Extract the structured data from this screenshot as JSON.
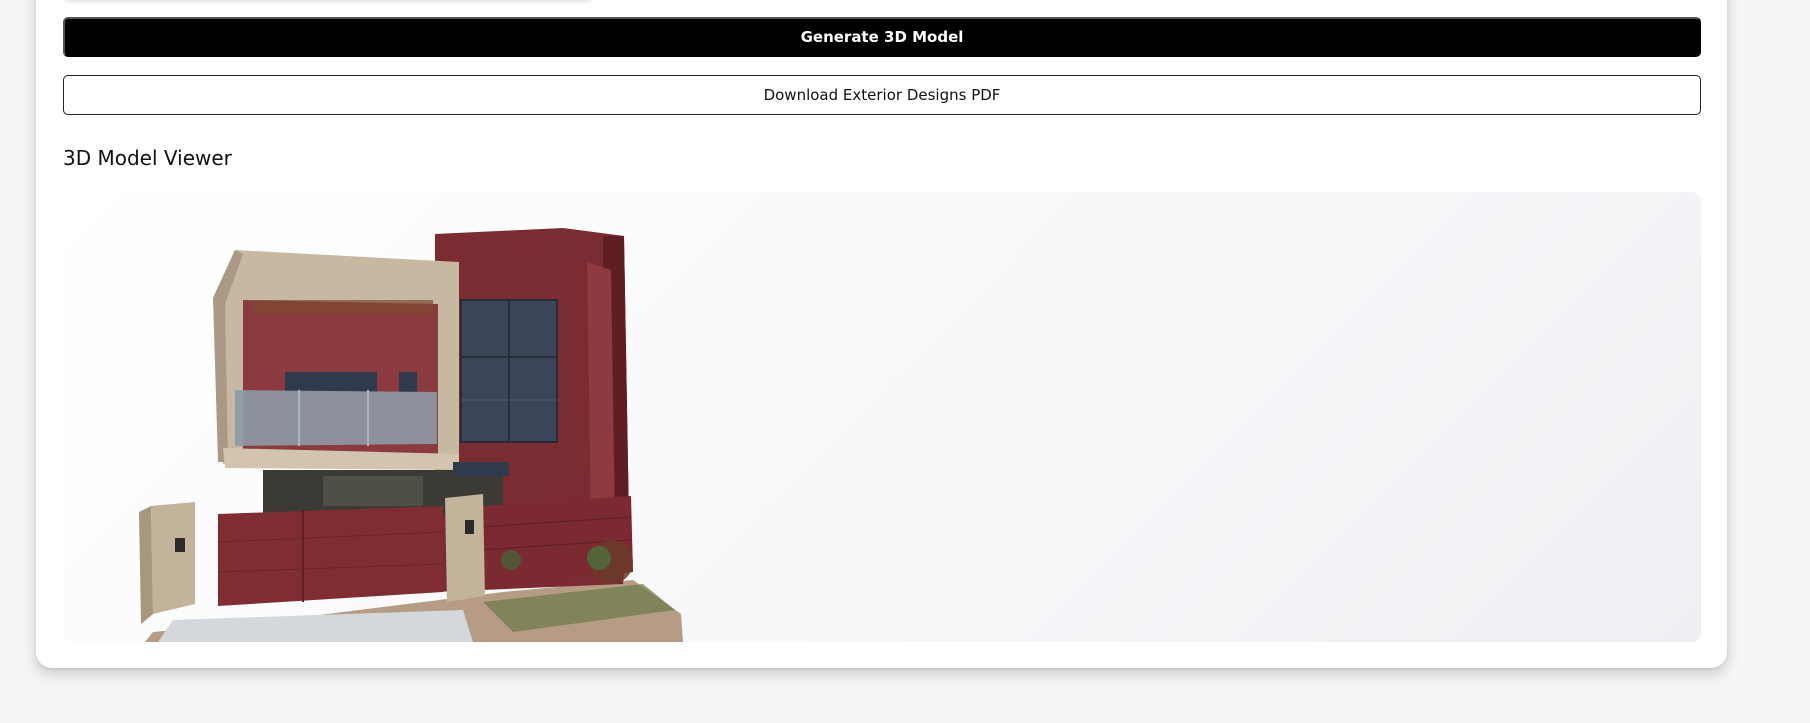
{
  "form": {
    "generate_label": "Generate 3D Model",
    "download_label": "Download Exterior Designs PDF"
  },
  "viewer": {
    "title": "3D Model Viewer",
    "model": "house-model"
  },
  "colors": {
    "primary_button": "#000000",
    "wall_red": "#7a2a30",
    "wall_beige": "#c9b9a3"
  }
}
